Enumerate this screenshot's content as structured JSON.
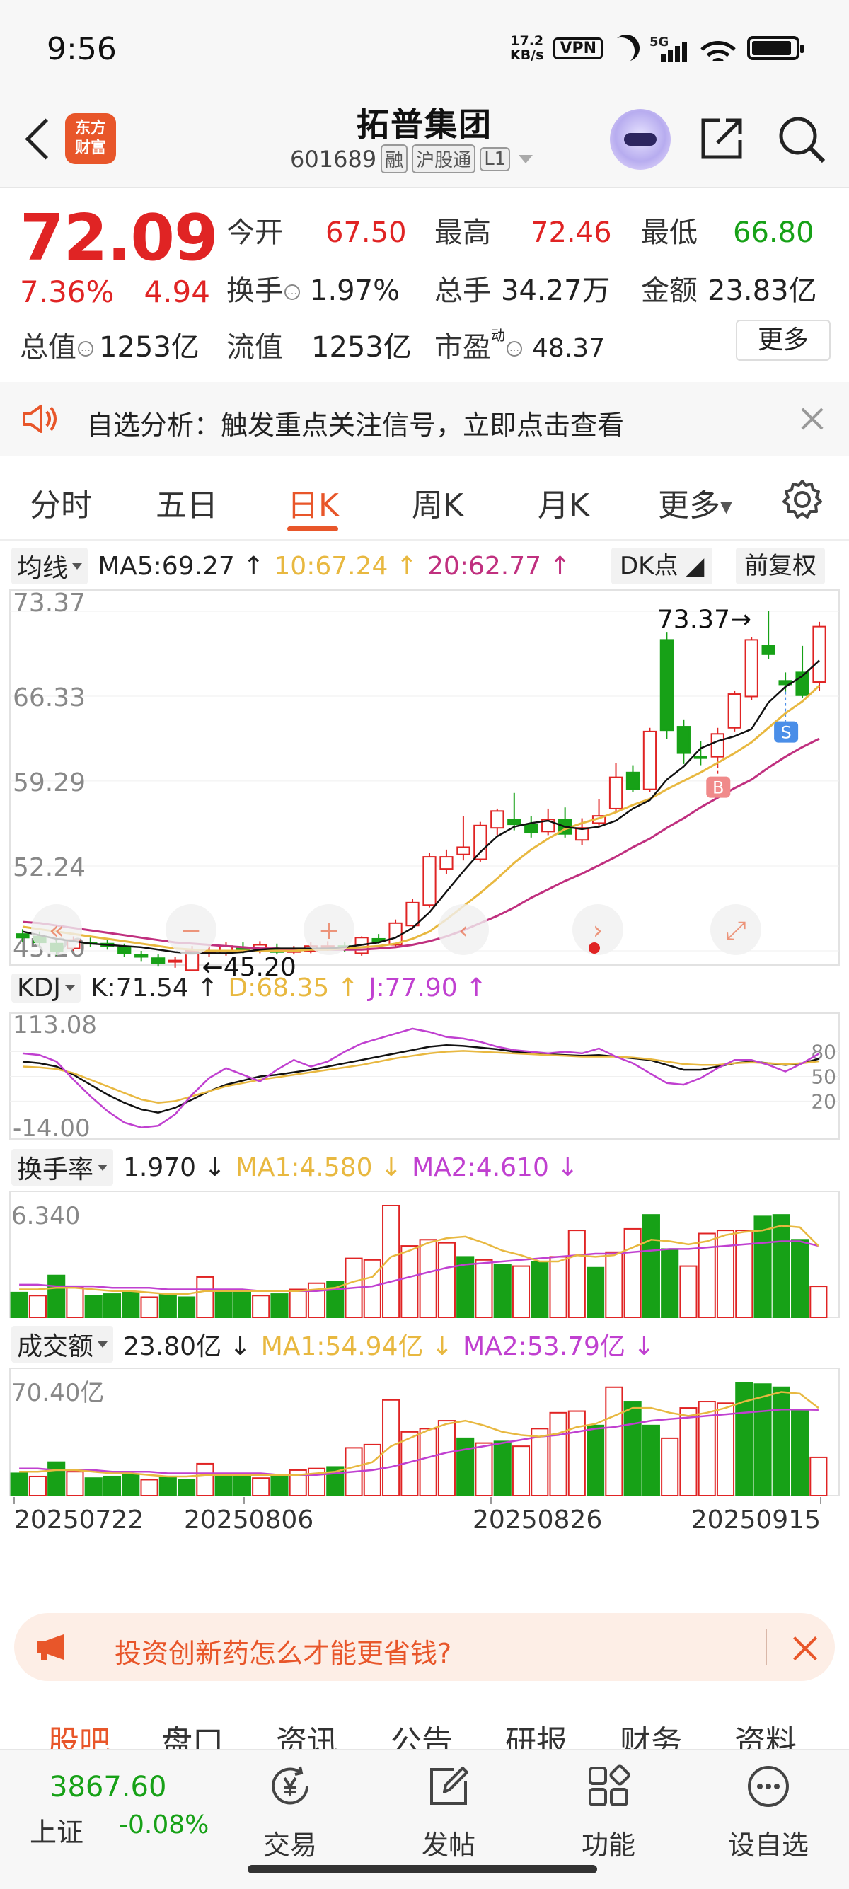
{
  "status_bar": {
    "time": "9:56",
    "net_speed": "17.2",
    "net_unit": "KB/s",
    "vpn": "VPN",
    "signal": "5G",
    "wifi_num": "6"
  },
  "header": {
    "logo_line1": "东方",
    "logo_line2": "财富",
    "name": "拓普集团",
    "code": "601689",
    "tags": [
      "融",
      "沪股通",
      "L1"
    ]
  },
  "quote": {
    "price": "72.09",
    "pct": "7.36%",
    "change": "4.94",
    "open_label": "今开",
    "open": "67.50",
    "high_label": "最高",
    "high": "72.46",
    "low_label": "最低",
    "low": "66.80",
    "turnover_label": "换手",
    "turnover": "1.97%",
    "vol_label": "总手",
    "volume": "34.27万",
    "amt_label": "金额",
    "amount": "23.83亿",
    "mcap_label": "总值",
    "mcap": "1253亿",
    "float_label": "流值",
    "float_cap": "1253亿",
    "pe_label": "市盈",
    "pe_sup": "动",
    "pe": "48.37",
    "more": "更多"
  },
  "alert": {
    "text": "自选分析：触发重点关注信号，立即点击查看"
  },
  "tabs": [
    {
      "label": "分时",
      "active": false
    },
    {
      "label": "五日",
      "active": false
    },
    {
      "label": "日K",
      "active": true
    },
    {
      "label": "周K",
      "active": false
    },
    {
      "label": "月K",
      "active": false
    },
    {
      "label": "更多",
      "active": false
    }
  ],
  "colors": {
    "up": "#e02424",
    "down": "#17a117",
    "ma5": "#111111",
    "ma10": "#e8b840",
    "ma20": "#c0307f",
    "accent": "#e8562a",
    "kdj_j": "#c040d0"
  },
  "indicators": {
    "ma": {
      "selector": "均线",
      "ma5": "MA5:69.27",
      "ma10": "10:67.24",
      "ma20": "20:62.77",
      "dk": "DK点",
      "adjust": "前复权"
    },
    "kdj": {
      "selector": "KDJ",
      "k": "K:71.54",
      "d": "D:68.35",
      "j": "J:77.90"
    },
    "turnover": {
      "selector": "换手率",
      "value": "1.970",
      "ma1": "MA1:4.580",
      "ma2": "MA2:4.610"
    },
    "amount": {
      "selector": "成交额",
      "value": "23.80亿",
      "ma1": "MA1:54.94亿",
      "ma2": "MA2:53.79亿"
    }
  },
  "chart_data": [
    {
      "type": "candlestick",
      "title": "日K",
      "y_ticks": [
        "73.37",
        "66.33",
        "59.29",
        "52.24",
        "45.20"
      ],
      "ylim": [
        45.2,
        73.37
      ],
      "x_ticks": [
        "20250722",
        "20250806",
        "20250826",
        "20250915"
      ],
      "annotations": {
        "max_label": "73.37",
        "min_label": "45.20",
        "buy_marker": "B",
        "sell_marker": "S"
      },
      "candles": [
        {
          "o": 46.6,
          "c": 46.3,
          "h": 47.0,
          "l": 45.9
        },
        {
          "o": 46.4,
          "c": 45.9,
          "h": 46.8,
          "l": 45.6
        },
        {
          "o": 45.8,
          "c": 45.2,
          "h": 46.2,
          "l": 44.8
        },
        {
          "o": 45.4,
          "c": 46.1,
          "h": 46.4,
          "l": 45.2
        },
        {
          "o": 45.9,
          "c": 45.8,
          "h": 46.3,
          "l": 45.5
        },
        {
          "o": 45.8,
          "c": 45.6,
          "h": 46.2,
          "l": 45.3
        },
        {
          "o": 45.5,
          "c": 45.0,
          "h": 45.8,
          "l": 44.7
        },
        {
          "o": 44.9,
          "c": 44.7,
          "h": 45.2,
          "l": 44.3
        },
        {
          "o": 44.6,
          "c": 44.2,
          "h": 44.9,
          "l": 43.9
        },
        {
          "o": 44.3,
          "c": 44.4,
          "h": 44.7,
          "l": 43.8
        },
        {
          "o": 43.6,
          "c": 45.2,
          "h": 45.6,
          "l": 43.5
        },
        {
          "o": 45.0,
          "c": 45.1,
          "h": 45.6,
          "l": 44.7
        },
        {
          "o": 45.0,
          "c": 45.6,
          "h": 45.9,
          "l": 44.8
        },
        {
          "o": 45.4,
          "c": 45.3,
          "h": 45.9,
          "l": 45.0
        },
        {
          "o": 45.3,
          "c": 45.7,
          "h": 46.0,
          "l": 45.0
        },
        {
          "o": 45.4,
          "c": 45.1,
          "h": 45.8,
          "l": 44.9
        },
        {
          "o": 45.1,
          "c": 45.3,
          "h": 45.6,
          "l": 44.9
        },
        {
          "o": 45.2,
          "c": 45.6,
          "h": 45.9,
          "l": 45.0
        },
        {
          "o": 45.5,
          "c": 45.6,
          "h": 46.0,
          "l": 45.2
        },
        {
          "o": 45.6,
          "c": 45.3,
          "h": 45.9,
          "l": 45.1
        },
        {
          "o": 45.0,
          "c": 46.3,
          "h": 46.4,
          "l": 44.8
        },
        {
          "o": 46.2,
          "c": 46.0,
          "h": 46.6,
          "l": 45.8
        },
        {
          "o": 45.7,
          "c": 47.5,
          "h": 47.8,
          "l": 45.5
        },
        {
          "o": 47.3,
          "c": 49.2,
          "h": 49.5,
          "l": 47.0
        },
        {
          "o": 49.0,
          "c": 53.0,
          "h": 53.3,
          "l": 48.8
        },
        {
          "o": 52.0,
          "c": 53.0,
          "h": 53.6,
          "l": 51.6
        },
        {
          "o": 53.2,
          "c": 53.8,
          "h": 56.4,
          "l": 52.7
        },
        {
          "o": 52.8,
          "c": 55.6,
          "h": 55.9,
          "l": 52.6
        },
        {
          "o": 55.4,
          "c": 56.8,
          "h": 57.0,
          "l": 54.8
        },
        {
          "o": 56.1,
          "c": 55.7,
          "h": 58.3,
          "l": 55.2
        },
        {
          "o": 55.7,
          "c": 55.0,
          "h": 56.4,
          "l": 54.6
        },
        {
          "o": 55.1,
          "c": 56.1,
          "h": 57.0,
          "l": 54.8
        },
        {
          "o": 56.1,
          "c": 54.9,
          "h": 57.1,
          "l": 54.6
        },
        {
          "o": 54.4,
          "c": 55.4,
          "h": 56.2,
          "l": 54.0
        },
        {
          "o": 55.8,
          "c": 56.4,
          "h": 57.8,
          "l": 55.6
        },
        {
          "o": 57.0,
          "c": 59.6,
          "h": 60.8,
          "l": 56.8
        },
        {
          "o": 60.0,
          "c": 58.6,
          "h": 60.6,
          "l": 58.4
        },
        {
          "o": 58.6,
          "c": 63.4,
          "h": 63.7,
          "l": 58.4
        },
        {
          "o": 71.0,
          "c": 63.5,
          "h": 71.6,
          "l": 62.8
        },
        {
          "o": 63.8,
          "c": 61.6,
          "h": 64.4,
          "l": 60.7
        },
        {
          "o": 61.3,
          "c": 61.2,
          "h": 62.6,
          "l": 60.6
        },
        {
          "o": 61.3,
          "c": 63.2,
          "h": 63.7,
          "l": 60.6
        },
        {
          "o": 63.7,
          "c": 66.5,
          "h": 66.8,
          "l": 63.4
        },
        {
          "o": 66.3,
          "c": 71.0,
          "h": 71.2,
          "l": 66.0
        },
        {
          "o": 70.5,
          "c": 69.8,
          "h": 73.4,
          "l": 69.4
        },
        {
          "o": 67.6,
          "c": 67.3,
          "h": 68.3,
          "l": 66.7
        },
        {
          "o": 68.3,
          "c": 66.4,
          "h": 70.5,
          "l": 66.2
        },
        {
          "o": 67.5,
          "c": 72.1,
          "h": 72.5,
          "l": 66.8
        }
      ],
      "ma5": [
        46.8,
        46.5,
        46.2,
        46.0,
        45.8,
        45.7,
        45.6,
        45.5,
        45.3,
        45.1,
        45.0,
        45.0,
        45.0,
        45.1,
        45.3,
        45.4,
        45.4,
        45.4,
        45.4,
        45.5,
        45.7,
        45.9,
        46.3,
        47.1,
        48.4,
        50.1,
        51.8,
        53.4,
        54.7,
        55.5,
        55.8,
        56.0,
        55.5,
        55.3,
        55.5,
        56.0,
        57.0,
        57.7,
        59.4,
        60.5,
        62.0,
        62.6,
        63.0,
        63.6,
        65.8,
        67.1,
        68.0,
        69.3
      ],
      "ma10": [
        47.2,
        47.0,
        46.8,
        46.6,
        46.4,
        46.2,
        46.0,
        45.8,
        45.6,
        45.4,
        45.3,
        45.2,
        45.2,
        45.2,
        45.2,
        45.2,
        45.2,
        45.3,
        45.3,
        45.4,
        45.5,
        45.6,
        45.8,
        46.2,
        46.8,
        47.8,
        48.9,
        50.0,
        51.2,
        52.5,
        53.6,
        54.5,
        55.3,
        55.8,
        56.2,
        56.7,
        57.3,
        57.8,
        58.6,
        59.3,
        60.0,
        60.8,
        61.6,
        62.5,
        63.7,
        64.9,
        65.9,
        67.2
      ],
      "ma20": [
        47.6,
        47.5,
        47.3,
        47.1,
        46.9,
        46.7,
        46.5,
        46.3,
        46.1,
        45.9,
        45.8,
        45.7,
        45.6,
        45.5,
        45.4,
        45.4,
        45.3,
        45.3,
        45.3,
        45.3,
        45.3,
        45.4,
        45.5,
        45.7,
        46.0,
        46.4,
        46.9,
        47.5,
        48.1,
        48.8,
        49.6,
        50.3,
        51.0,
        51.6,
        52.3,
        53.0,
        53.8,
        54.5,
        55.4,
        56.2,
        57.1,
        57.9,
        58.7,
        59.4,
        60.4,
        61.3,
        62.1,
        62.8
      ]
    },
    {
      "type": "line",
      "title": "KDJ",
      "y_ticks": [
        "113.08",
        "-14.00"
      ],
      "right_ticks": [
        "80",
        "50",
        "20"
      ],
      "ylim": [
        -14.0,
        113.08
      ],
      "series": [
        {
          "name": "K",
          "values": [
            68,
            66,
            62,
            52,
            40,
            28,
            18,
            10,
            6,
            12,
            22,
            32,
            40,
            45,
            50,
            52,
            55,
            58,
            62,
            66,
            70,
            74,
            78,
            82,
            86,
            88,
            87,
            85,
            83,
            80,
            78,
            77,
            76,
            75,
            76,
            74,
            72,
            70,
            64,
            58,
            58,
            62,
            66,
            68,
            66,
            64,
            66,
            71.5
          ]
        },
        {
          "name": "D",
          "values": [
            62,
            61,
            59,
            54,
            46,
            38,
            30,
            22,
            18,
            20,
            26,
            32,
            38,
            42,
            46,
            49,
            52,
            55,
            58,
            61,
            64,
            68,
            72,
            75,
            78,
            80,
            81,
            80,
            79,
            78,
            77,
            76,
            75,
            74,
            74,
            74,
            73,
            71,
            68,
            65,
            64,
            64,
            66,
            67,
            66,
            65,
            66,
            68.4
          ]
        },
        {
          "name": "J",
          "values": [
            78,
            76,
            68,
            46,
            26,
            8,
            -6,
            -12,
            -10,
            4,
            28,
            48,
            60,
            52,
            44,
            58,
            70,
            62,
            68,
            80,
            90,
            96,
            102,
            108,
            104,
            98,
            96,
            92,
            86,
            82,
            80,
            78,
            80,
            78,
            84,
            74,
            66,
            54,
            42,
            40,
            48,
            60,
            70,
            70,
            64,
            56,
            66,
            77.9
          ]
        }
      ]
    },
    {
      "type": "bar",
      "title": "换手率",
      "y_ticks": [
        "6.340"
      ],
      "values": [
        1.6,
        1.4,
        2.7,
        1.9,
        1.4,
        1.5,
        1.6,
        1.3,
        1.5,
        1.3,
        2.6,
        1.6,
        1.7,
        1.4,
        1.5,
        1.8,
        2.2,
        2.3,
        3.8,
        3.7,
        7.2,
        4.6,
        5.0,
        4.8,
        3.9,
        3.7,
        3.4,
        3.3,
        3.6,
        3.9,
        5.6,
        3.2,
        4.2,
        5.7,
        6.6,
        4.4,
        3.3,
        5.4,
        5.6,
        5.6,
        6.5,
        6.6,
        5.0,
        2.0
      ],
      "up": [
        0,
        1,
        0,
        1,
        0,
        0,
        0,
        1,
        0,
        0,
        1,
        0,
        0,
        1,
        0,
        1,
        1,
        0,
        1,
        1,
        1,
        1,
        1,
        1,
        0,
        1,
        0,
        1,
        0,
        1,
        1,
        0,
        1,
        1,
        0,
        0,
        1,
        1,
        1,
        1,
        0,
        0,
        0,
        1
      ],
      "ma1": [
        1.8,
        1.8,
        1.9,
        1.9,
        1.8,
        1.7,
        1.7,
        1.6,
        1.5,
        1.5,
        1.7,
        1.7,
        1.7,
        1.7,
        1.7,
        1.7,
        1.8,
        1.9,
        2.3,
        2.6,
        3.9,
        4.3,
        4.8,
        5.1,
        5.2,
        4.8,
        4.3,
        4.0,
        3.6,
        3.6,
        4.0,
        3.9,
        4.0,
        4.5,
        5.0,
        4.9,
        4.7,
        4.9,
        5.3,
        5.5,
        5.6,
        5.9,
        5.8,
        4.6
      ],
      "ma2": [
        2.1,
        2.1,
        2.0,
        2.0,
        2.0,
        1.9,
        1.9,
        1.9,
        1.8,
        1.8,
        1.8,
        1.8,
        1.8,
        1.7,
        1.7,
        1.7,
        1.7,
        1.8,
        1.9,
        2.0,
        2.3,
        2.6,
        2.9,
        3.2,
        3.4,
        3.5,
        3.6,
        3.7,
        3.8,
        3.9,
        4.0,
        4.1,
        4.1,
        4.2,
        4.3,
        4.4,
        4.4,
        4.5,
        4.6,
        4.7,
        4.8,
        4.9,
        4.9,
        4.6
      ]
    },
    {
      "type": "bar",
      "title": "成交额",
      "y_ticks": [
        "70.40亿"
      ],
      "values": [
        14,
        12,
        21,
        15,
        11,
        12,
        13,
        10,
        12,
        10,
        20,
        12,
        13,
        11,
        12,
        16,
        17,
        18,
        30,
        32,
        60,
        40,
        42,
        47,
        36,
        33,
        34,
        31,
        42,
        52,
        53,
        44,
        68,
        59,
        44,
        36,
        55,
        59,
        58,
        71,
        70,
        68,
        53,
        24
      ],
      "up": [
        0,
        1,
        0,
        1,
        0,
        0,
        0,
        1,
        0,
        0,
        1,
        0,
        0,
        1,
        0,
        1,
        1,
        0,
        1,
        1,
        1,
        1,
        1,
        1,
        0,
        1,
        0,
        1,
        1,
        1,
        1,
        0,
        1,
        0,
        0,
        1,
        1,
        1,
        1,
        0,
        0,
        0,
        0,
        1
      ],
      "ma1": [
        15,
        15,
        16,
        16,
        15,
        14,
        14,
        13,
        12,
        12,
        13,
        13,
        13,
        13,
        13,
        13,
        14,
        15,
        18,
        21,
        31,
        36,
        41,
        45,
        47,
        44,
        40,
        38,
        37,
        39,
        43,
        45,
        50,
        55,
        55,
        52,
        50,
        52,
        55,
        59,
        62,
        65,
        64,
        55
      ],
      "ma2": [
        17,
        17,
        16,
        16,
        16,
        15,
        15,
        15,
        14,
        14,
        14,
        14,
        14,
        14,
        13,
        13,
        13,
        14,
        15,
        16,
        18,
        21,
        24,
        27,
        29,
        31,
        33,
        35,
        37,
        38,
        40,
        42,
        43,
        45,
        47,
        48,
        49,
        50,
        51,
        52,
        53,
        54,
        54,
        53.8
      ]
    }
  ],
  "promo": {
    "text": "投资创新药怎么才能更省钱?"
  },
  "section_tabs": [
    "股吧",
    "盘口",
    "资讯",
    "公告",
    "研报",
    "财务",
    "资料"
  ],
  "bottom_bar": {
    "index_value": "3867.60",
    "index_name": "上证",
    "index_change": "-0.08%",
    "items": [
      {
        "label": "交易",
        "icon": "yen-icon"
      },
      {
        "label": "发帖",
        "icon": "edit-icon"
      },
      {
        "label": "功能",
        "icon": "grid-icon"
      },
      {
        "label": "设自选",
        "icon": "more-icon"
      }
    ]
  }
}
